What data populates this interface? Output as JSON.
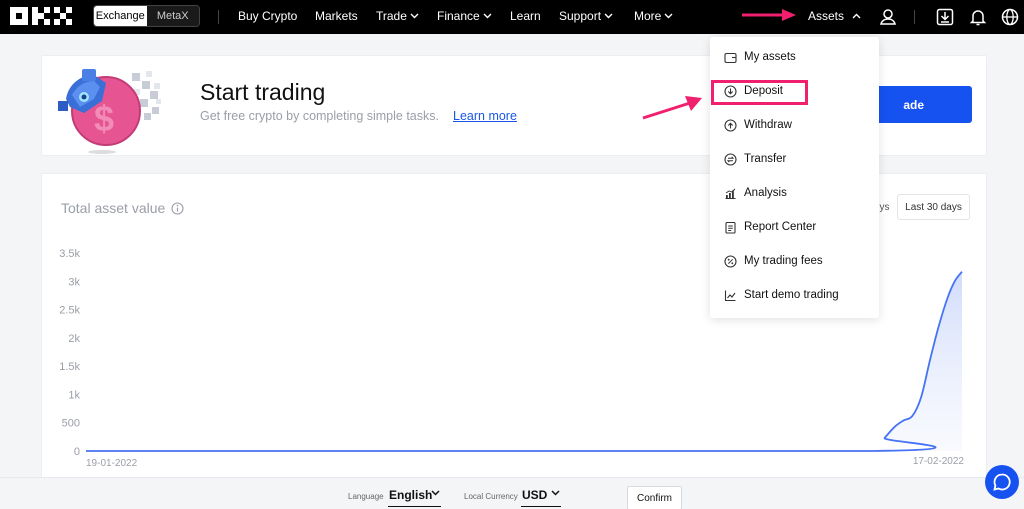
{
  "nav": {
    "mode_options": [
      "Exchange",
      "MetaX"
    ],
    "items": [
      {
        "label": "Buy Crypto",
        "has_chevron": false
      },
      {
        "label": "Markets",
        "has_chevron": false
      },
      {
        "label": "Trade",
        "has_chevron": true
      },
      {
        "label": "Finance",
        "has_chevron": true
      },
      {
        "label": "Learn",
        "has_chevron": false
      },
      {
        "label": "Support",
        "has_chevron": true
      },
      {
        "label": "More",
        "has_chevron": true
      }
    ],
    "assets_label": "Assets",
    "icons": [
      "user-icon",
      "download-icon",
      "bell-icon",
      "globe-icon"
    ]
  },
  "banner": {
    "title": "Start trading",
    "subtitle": "Get free crypto by completing simple tasks.",
    "link": "Learn more",
    "button_label": "ade"
  },
  "chart_card": {
    "title": "Total asset value",
    "range_buttons": [
      "ys",
      "Last 30 days"
    ],
    "active_range": "Last 30 days"
  },
  "chart_data": {
    "type": "area",
    "x_start_label": "19-01-2022",
    "x_end_label": "17-02-2022",
    "y_ticks": [
      "0",
      "500",
      "1k",
      "1.5k",
      "2k",
      "2.5k",
      "3k",
      "3.5k"
    ],
    "ylim": [
      0,
      3500
    ],
    "x": [
      0,
      27,
      27.35,
      27.7,
      28.0,
      28.3,
      28.6,
      28.9,
      29.2,
      29.5,
      29.75,
      30.0
    ],
    "values": [
      0,
      0,
      230,
      430,
      540,
      620,
      950,
      1600,
      2200,
      2700,
      3000,
      3170
    ],
    "line_color": "#4673f5",
    "fill_color": "#dde5fb"
  },
  "dropdown": {
    "items": [
      {
        "label": "My assets",
        "icon": "wallet-icon"
      },
      {
        "label": "Deposit",
        "icon": "deposit-icon"
      },
      {
        "label": "Withdraw",
        "icon": "withdraw-icon"
      },
      {
        "label": "Transfer",
        "icon": "transfer-icon"
      },
      {
        "label": "Analysis",
        "icon": "analysis-icon"
      },
      {
        "label": "Report Center",
        "icon": "report-icon"
      },
      {
        "label": "My trading fees",
        "icon": "fees-icon"
      },
      {
        "label": "Start demo trading",
        "icon": "demo-chart-icon"
      }
    ],
    "highlighted": "Deposit"
  },
  "footer": {
    "language_label": "Language",
    "language_value": "English",
    "currency_label": "Local Currency",
    "currency_value": "USD",
    "confirm_label": "Confirm"
  },
  "colors": {
    "accent": "#1652f0",
    "highlight": "#f0206e",
    "nav_bg": "#000000"
  }
}
